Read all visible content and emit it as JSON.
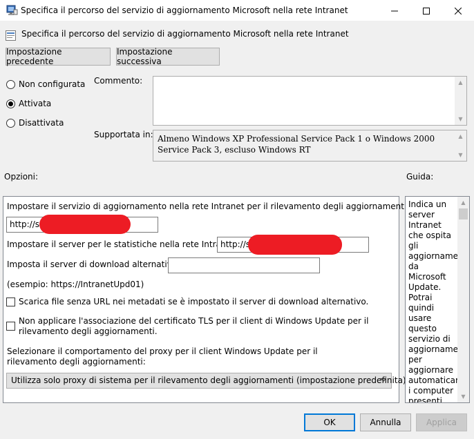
{
  "window": {
    "title": "Specifica il percorso del servizio di aggiornamento Microsoft nella rete Intranet"
  },
  "header": {
    "policy_title": "Specifica il percorso del servizio di aggiornamento Microsoft nella rete Intranet"
  },
  "nav": {
    "prev_label": "Impostazione precedente",
    "next_label": "Impostazione successiva"
  },
  "state": {
    "options": [
      {
        "label": "Non configurata",
        "selected": false
      },
      {
        "label": "Attivata",
        "selected": true
      },
      {
        "label": "Disattivata",
        "selected": false
      }
    ]
  },
  "comment": {
    "label": "Commento:",
    "value": ""
  },
  "supported": {
    "label": "Supportata in:",
    "value": "Almeno Windows XP Professional Service Pack 1 o Windows 2000 Service Pack 3, escluso Windows RT"
  },
  "options_section": {
    "label": "Opzioni:",
    "update_service_label": "Impostare il servizio di aggiornamento nella rete Intranet per il rilevamento degli aggiornamenti:",
    "update_service_value": "http://sv",
    "stats_server_label": "Impostare il server per le statistiche nella rete Intranet:",
    "stats_server_value": "http://sv",
    "alt_download_label": "Imposta il server di download alternativo:",
    "alt_download_value": "",
    "example_text": "(esempio: https://IntranetUpd01)",
    "checkbox1_label": "Scarica file senza URL nei metadati se è impostato il server di download alternativo.",
    "checkbox1_checked": false,
    "checkbox2_label": "Non applicare l'associazione del certificato TLS per il client di Windows Update per il rilevamento degli aggiornamenti.",
    "checkbox2_checked": false,
    "proxy_label": "Selezionare il comportamento del proxy per il client Windows Update per il rilevamento degli aggiornamenti:",
    "proxy_selected": "Utilizza solo proxy di sistema per il rilevamento degli aggiornamenti (impostazione predefinita)"
  },
  "guide": {
    "label": "Guida:",
    "text": "Indica un server Intranet che ospita gli aggiornamenti da Microsoft Update. Potrai quindi usare questo servizio di aggiornamento per aggiornare automaticamente i computer presenti"
  },
  "footer": {
    "ok_label": "OK",
    "cancel_label": "Annulla",
    "apply_label": "Applica"
  },
  "colors": {
    "accent": "#0078d7",
    "redaction": "#ed1c24"
  }
}
